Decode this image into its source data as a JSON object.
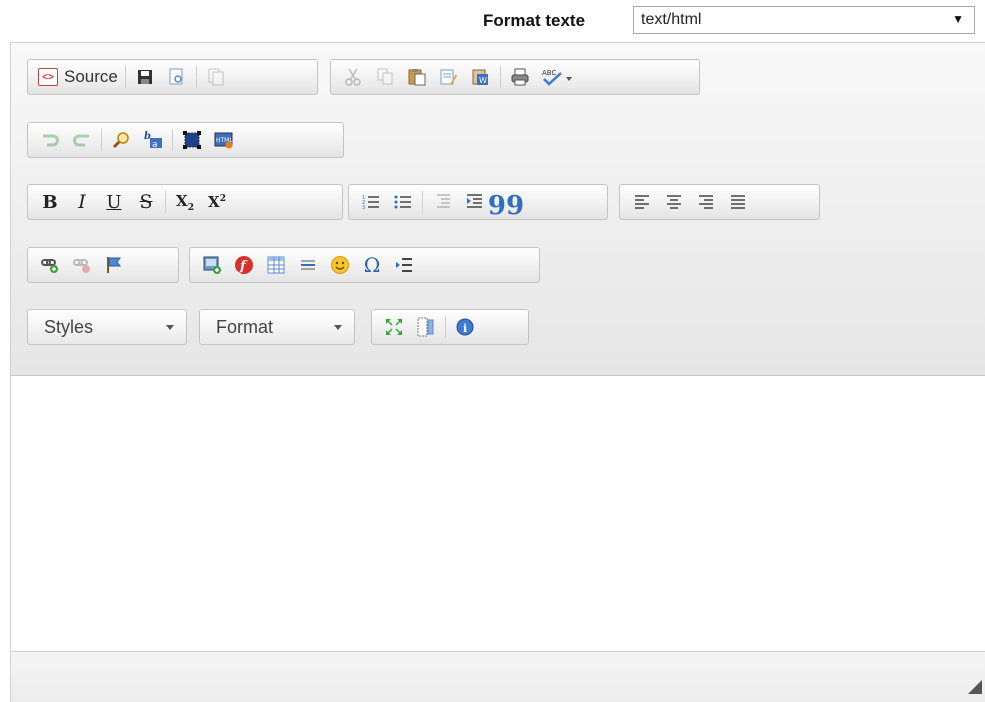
{
  "format": {
    "label": "Format texte",
    "selected": "text/html"
  },
  "toolbar": {
    "source_label": "Source",
    "styles_label": "Styles",
    "format_label": "Format"
  },
  "icons": {
    "row1": [
      "source-icon",
      "save-icon",
      "preview-icon",
      "templates-icon",
      "cut-icon",
      "copy-icon",
      "paste-icon",
      "paste-text-icon",
      "paste-word-icon",
      "print-icon",
      "spellcheck-icon"
    ],
    "row2": [
      "undo-icon",
      "redo-icon",
      "find-icon",
      "replace-icon",
      "select-all-icon",
      "html-icon"
    ],
    "row3": [
      "bold-icon",
      "italic-icon",
      "underline-icon",
      "strikethrough-icon",
      "subscript-icon",
      "superscript-icon",
      "numbered-list-icon",
      "bulleted-list-icon",
      "outdent-icon",
      "indent-icon",
      "blockquote-icon",
      "align-left-icon",
      "align-center-icon",
      "align-right-icon",
      "justify-icon"
    ],
    "row4": [
      "link-icon",
      "unlink-icon",
      "anchor-icon",
      "image-icon",
      "flash-icon",
      "table-icon",
      "horizontal-rule-icon",
      "smiley-icon",
      "special-char-icon",
      "page-break-icon"
    ],
    "row5": [
      "maximize-icon",
      "show-blocks-icon",
      "about-icon"
    ]
  },
  "glyphs": {
    "bold": "B",
    "italic": "I",
    "underline": "U",
    "strike": "S",
    "sub": "X",
    "sub_small": "2",
    "sup": "X",
    "sup_small": "2",
    "quote": "99",
    "omega": "Ω",
    "disk": "🖫",
    "smiley": "☺",
    "info": "i",
    "flash": "f",
    "html": "HTML"
  },
  "colors": {
    "accent_blue": "#2f6fbf",
    "flash_red": "#d9302c",
    "smiley_yellow": "#f6c42b"
  }
}
